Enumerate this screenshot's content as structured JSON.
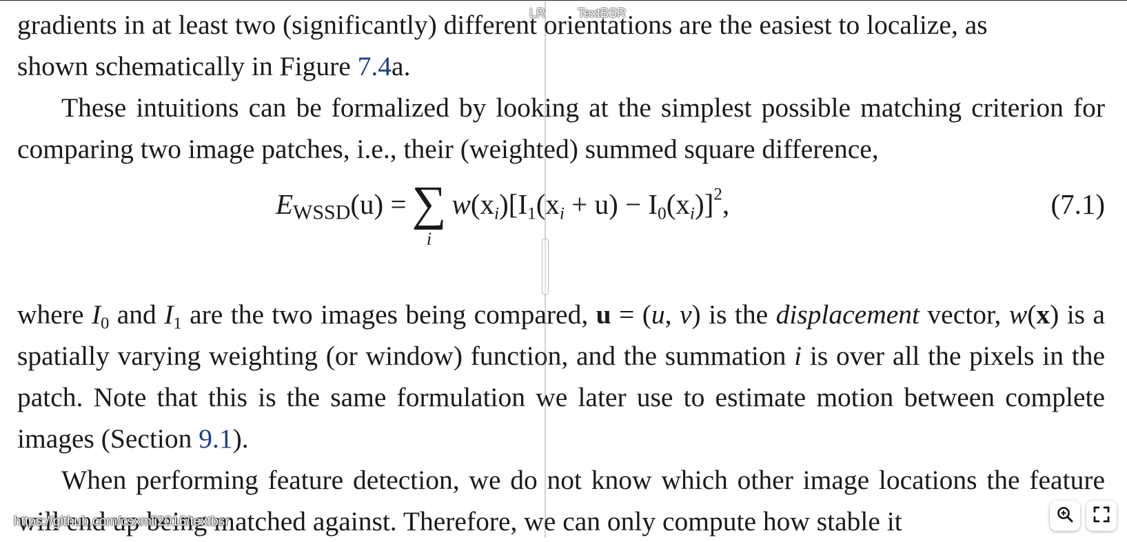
{
  "overlay": {
    "left_label": "LR",
    "right_label": "TextBSR",
    "credit": "https://github.com/csxmli2016/textbsr"
  },
  "document": {
    "para1": {
      "line1": "gradients in at least two (significantly) different orientations are the easiest to localize, as",
      "line2_pre": "shown schematically in Figure ",
      "line2_link": "7.4",
      "line2_post": "a."
    },
    "para2": {
      "line1": "These intuitions can be formalized by looking at the simplest possible matching criterion",
      "line2": "for comparing two image patches, i.e., their (weighted) summed square difference,"
    },
    "equation": {
      "lhs_E": "E",
      "lhs_sub": "WSSD",
      "lhs_arg": "(u) =",
      "sum_symbol": "∑",
      "sum_index": "i",
      "body_w": "w",
      "body_rest_1": "(x",
      "body_rest_i": "i",
      "body_rest_2": ")[I",
      "body_I1_sub": "1",
      "body_rest_3": "(x",
      "body_rest_i2": "i",
      "body_rest_4": " + u) − I",
      "body_I0_sub": "0",
      "body_rest_5": "(x",
      "body_rest_i3": "i",
      "body_rest_6": ")]",
      "body_sup": "2",
      "body_end": ",",
      "number": "(7.1)"
    },
    "para3": {
      "t1": "where ",
      "I": "I",
      "sub0": "0",
      "t2": " and ",
      "sub1": "1",
      "t3": " are the two images being compared, ",
      "u": "u",
      "t4": " = (",
      "uu": "u",
      "comma": ", ",
      "vv": "v",
      "t5": ") is the ",
      "disp": "displacement",
      "t6": " vector,",
      "w": "w",
      "t7": "(",
      "x": "x",
      "t8": ") is a spatially varying weighting (or window) function, and the summation ",
      "ii": "i",
      "t9": " is over all",
      "line3": "the pixels in the patch. Note that this is the same formulation we later use to estimate motion",
      "line4_pre": "between complete images (Section ",
      "line4_link": "9.1",
      "line4_post": ")."
    },
    "para4": {
      "line1": "When performing feature detection, we do not know which other image locations the",
      "line2": "feature will end up being matched against. Therefore, we can only compute how stable it"
    }
  },
  "toolbar": {
    "zoom_icon": "zoom-in-icon",
    "fullscreen_icon": "fullscreen-icon"
  }
}
